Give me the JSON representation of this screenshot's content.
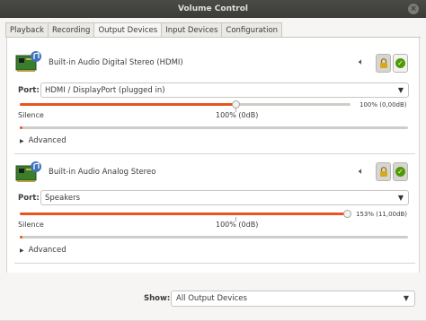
{
  "window": {
    "title": "Volume Control"
  },
  "tabs": [
    {
      "label": "Playback",
      "active": false
    },
    {
      "label": "Recording",
      "active": false
    },
    {
      "label": "Output Devices",
      "active": true
    },
    {
      "label": "Input Devices",
      "active": false
    },
    {
      "label": "Configuration",
      "active": false
    }
  ],
  "devices": [
    {
      "name": "Built-in Audio Digital Stereo (HDMI)",
      "port_label": "Port:",
      "port_value": "HDMI / DisplayPort (plugged in)",
      "volume_percent": 100,
      "volume_text": "100% (0,00dB)",
      "scale_silence": "Silence",
      "scale_100": "100% (0dB)",
      "advanced_label": "Advanced",
      "locked": true,
      "is_default": true
    },
    {
      "name": "Built-in Audio Analog Stereo",
      "port_label": "Port:",
      "port_value": "Speakers",
      "volume_percent": 153,
      "volume_text": "153% (11,00dB)",
      "scale_silence": "Silence",
      "scale_100": "100% (0dB)",
      "advanced_label": "Advanced",
      "locked": true,
      "is_default": false
    }
  ],
  "show": {
    "label": "Show:",
    "value": "All Output Devices"
  },
  "colors": {
    "accent": "#e95420",
    "titlebar": "#3b3b38",
    "default_green": "#4e9a06"
  },
  "icons": {
    "device": "sound-card-icon",
    "mute": "speaker-icon",
    "lock": "lock-icon",
    "default": "check-icon",
    "dropdown": "chevron-down-icon",
    "advanced": "disclosure-triangle-icon"
  }
}
